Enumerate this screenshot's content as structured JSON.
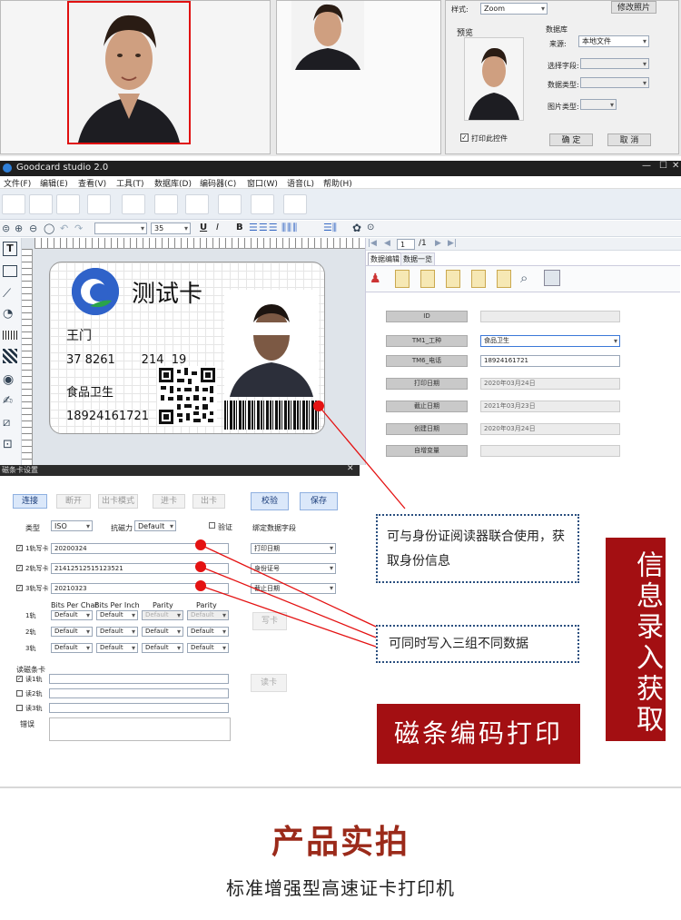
{
  "top_dialog": {
    "style_label": "样式:",
    "style_value": "Zoom",
    "modify_photo": "修改照片",
    "preview_label": "预览",
    "database_label": "数据库",
    "source_label": "来源:",
    "source_value": "本地文件",
    "select_field": "选择字段:",
    "data_type": "数据类型:",
    "image_type": "图片类型:",
    "print_control": "打印此控件",
    "ok": "确 定",
    "cancel": "取 消"
  },
  "app": {
    "title": "Goodcard studio 2.0",
    "menu": [
      "文件(F)",
      "编辑(E)",
      "查看(V)",
      "工具(T)",
      "数据库(D)",
      "编码器(C)",
      "窗口(W)",
      "语音(L)",
      "帮助(H)"
    ],
    "font_size": "35",
    "bold": "B",
    "underline": "U",
    "italic": "I",
    "nav_page": "1",
    "nav_total": "/1",
    "tabs": [
      "数据编辑",
      "数据一览"
    ]
  },
  "card": {
    "logo_text": "测试卡",
    "name": "王门",
    "id_number": "37 8261       214  19",
    "category": "食品卫生",
    "phone": "18924161721"
  },
  "fields": [
    {
      "label": "ID",
      "value": ""
    },
    {
      "label": "TM1_工种",
      "value": "食品卫生"
    },
    {
      "label": "TM6_电话",
      "value": "18924161721"
    },
    {
      "label": "打印日期",
      "value": "2020年03月24日"
    },
    {
      "label": "截止日期",
      "value": "2021年03月23日"
    },
    {
      "label": "创建日期",
      "value": "2020年03月24日"
    },
    {
      "label": "自增变量",
      "value": ""
    }
  ],
  "mag": {
    "title": "磁条卡设置",
    "close": "✕",
    "buttons": [
      "连接",
      "断开",
      "出卡模式",
      "进卡",
      "出卡",
      "校验",
      "保存"
    ],
    "type_label": "类型",
    "type_value": "ISO",
    "coercivity_label": "抗磁力",
    "coercivity_value": "Default",
    "verify": "验证",
    "bind_label": "绑定数据字段",
    "tracks": [
      {
        "label": "1轨写卡",
        "value": "20200324",
        "bind": "打印日期"
      },
      {
        "label": "2轨写卡",
        "value": "21412512515123521",
        "bind": "身份证号"
      },
      {
        "label": "3轨写卡",
        "value": "20210323",
        "bind": "截止日期"
      }
    ],
    "col_bpc": "Bits Per Char",
    "col_bpi": "Bits Per Inch",
    "col_parity": "Parity",
    "col_parity2": "Parity",
    "rows": [
      "1轨",
      "2轨",
      "3轨"
    ],
    "default": "Default",
    "write_btn": "写卡",
    "read_label": "读磁条卡",
    "read_tracks": [
      "读1轨",
      "读2轨",
      "读3轨"
    ],
    "read_btn": "读卡",
    "error_label": "错误"
  },
  "callouts": {
    "id_reader": "可与身份证阅读器联合使用，获取身份信息",
    "three_tracks": "可同时写入三组不同数据",
    "info_entry": "信息录入获取",
    "mag_print": "磁条编码打印"
  },
  "footer": {
    "title": "产品实拍",
    "subtitle": "标准增强型高速证卡打印机"
  },
  "colors": {
    "red": "#a30f12",
    "title": "#9b2a1a"
  }
}
